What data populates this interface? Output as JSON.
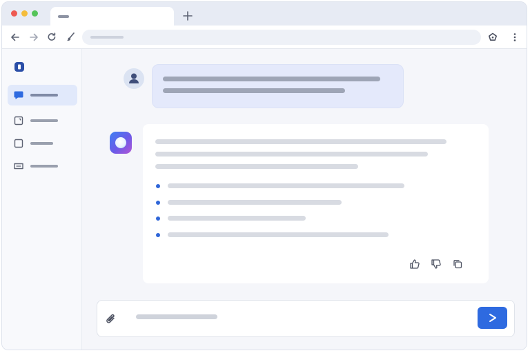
{
  "browser": {
    "tab": {
      "title_placeholder": true
    },
    "controls": [
      "back-icon",
      "forward-icon",
      "reload-icon",
      "brush-icon",
      "extension-icon",
      "kebab-menu-icon"
    ],
    "new_tab_icon": "plus-icon"
  },
  "sidebar": {
    "logo": "app-logo-icon",
    "items": [
      {
        "icon": "chat-bubble-icon",
        "active": true
      },
      {
        "icon": "document-icon",
        "active": false
      },
      {
        "icon": "square-icon",
        "active": false
      },
      {
        "icon": "list-icon",
        "active": false
      }
    ]
  },
  "conversation": {
    "user_message": {
      "avatar": "user-avatar-icon",
      "text_lines": 2
    },
    "assistant_message": {
      "avatar": "assistant-logo-icon",
      "paragraph_lines": 3,
      "bullet_count": 4,
      "actions": [
        "thumbs-up-icon",
        "thumbs-down-icon",
        "copy-icon"
      ]
    }
  },
  "composer": {
    "attach_icon": "paperclip-icon",
    "send_icon": "send-arrow-icon"
  },
  "colors": {
    "accent": "#2e6ae0",
    "active_nav_bg": "#e1e9fb",
    "user_bubble_bg": "#e4e9fb",
    "traffic_red": "#ee5a52",
    "traffic_yellow": "#f4bd3c",
    "traffic_green": "#55c45a"
  }
}
